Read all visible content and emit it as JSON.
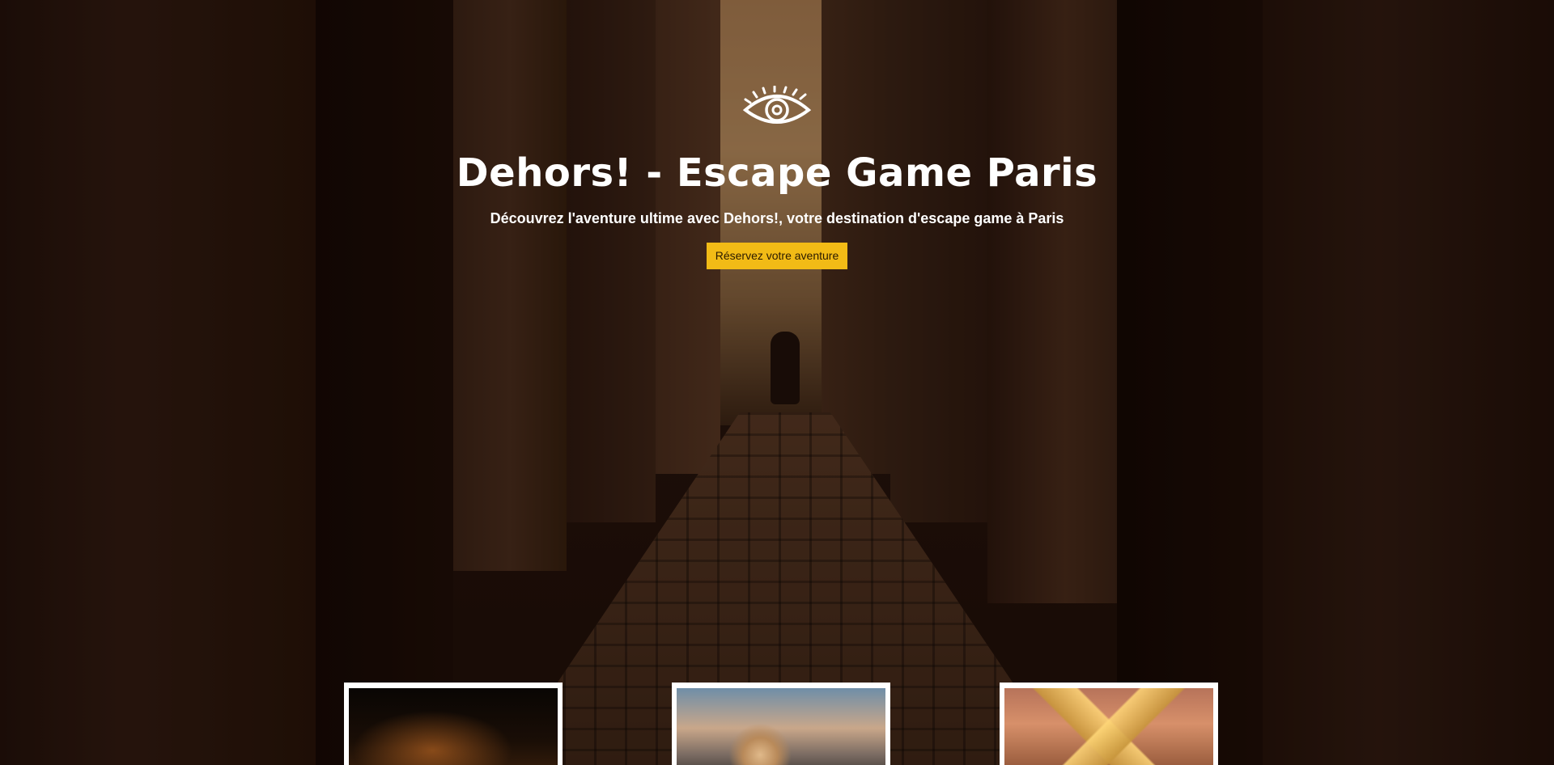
{
  "hero": {
    "logo_icon": "eye-icon",
    "title": "Dehors! - Escape Game Paris",
    "subtitle": "Découvrez l'aventure ultime avec Dehors!, votre destination d'escape game à Paris",
    "cta_label": "Réservez votre aventure"
  },
  "cards": [
    {
      "image": "castle-night-image"
    },
    {
      "image": "astronaut-cockpit-image"
    },
    {
      "image": "louvre-pyramid-image"
    }
  ],
  "colors": {
    "accent": "#f2bb16",
    "text": "#ffffff",
    "background": "#1a0d08"
  }
}
